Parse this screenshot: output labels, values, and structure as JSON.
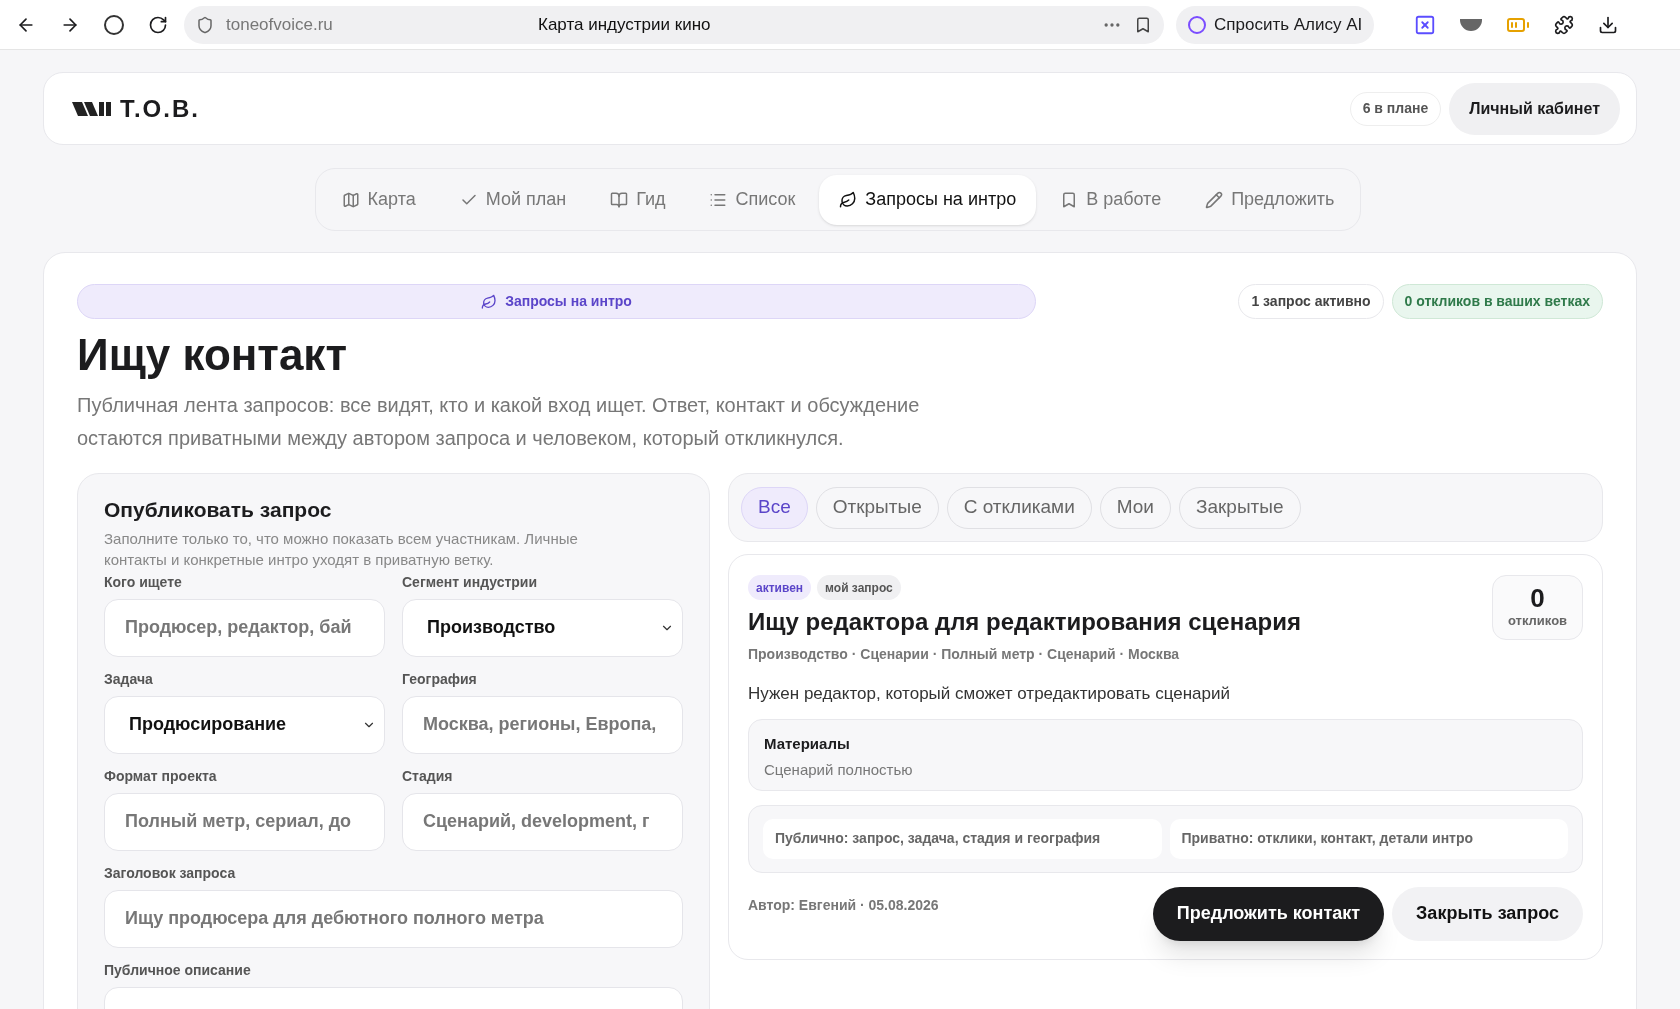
{
  "browser": {
    "url": "toneofvoice.ru",
    "title": "Карта индустрии кино",
    "ask_button": "Спросить Алису AI"
  },
  "header": {
    "logo_text": "Т.О.В.",
    "plan_badge": "6 в плане",
    "account_button": "Личный кабинет"
  },
  "nav": [
    {
      "label": "Карта",
      "selected": false
    },
    {
      "label": "Мой план",
      "selected": false
    },
    {
      "label": "Гид",
      "selected": false
    },
    {
      "label": "Список",
      "selected": false
    },
    {
      "label": "Запросы на интро",
      "selected": true
    },
    {
      "label": "В работе",
      "selected": false
    },
    {
      "label": "Предложить",
      "selected": false
    }
  ],
  "page": {
    "section_badge": "Запросы на интро",
    "stats": [
      {
        "text": "1 запрос активно",
        "kind": "neutral"
      },
      {
        "text": "0 откликов в ваших ветках",
        "kind": "success"
      }
    ],
    "title": "Ищу контакт",
    "description": "Публичная лента запросов: все видят, кто и какой вход ищет. Ответ, контакт и обсуждение остаются приватными между автором запроса и человеком, который откликнулся."
  },
  "form": {
    "title": "Опубликовать запрос",
    "description": "Заполните только то, что можно показать всем участникам. Личные контакты и конкретные интро уходят в приватную ветку.",
    "fields": [
      {
        "label": "Кого ищете",
        "kind": "input",
        "placeholder": "Продюсер, редактор, бай"
      },
      {
        "label": "Сегмент индустрии",
        "kind": "select",
        "value": "Производство"
      },
      {
        "label": "Задача",
        "kind": "select",
        "value": "Продюсирование"
      },
      {
        "label": "География",
        "kind": "input",
        "placeholder": "Москва, регионы, Европа,"
      },
      {
        "label": "Формат проекта",
        "kind": "input",
        "placeholder": "Полный метр, сериал, до"
      },
      {
        "label": "Стадия",
        "kind": "input",
        "placeholder": "Сценарий, development, г"
      },
      {
        "label": "Заголовок запроса",
        "kind": "wide",
        "placeholder": "Ищу продюсера для дебютного полного метра"
      },
      {
        "label": "Публичное описание",
        "kind": "wide"
      }
    ]
  },
  "filters": [
    {
      "label": "Все",
      "selected": true
    },
    {
      "label": "Открытые",
      "selected": false
    },
    {
      "label": "С откликами",
      "selected": false
    },
    {
      "label": "Мои",
      "selected": false
    },
    {
      "label": "Закрытые",
      "selected": false
    }
  ],
  "request": {
    "tags": [
      {
        "text": "активен",
        "kind": "status"
      },
      {
        "text": "мой запрос",
        "kind": "owner"
      }
    ],
    "title": "Ищу редактора для редактирования сценария",
    "meta": "Производство · Сценарии · Полный метр · Сценарий · Москва",
    "responses_count": "0",
    "responses_label": "откликов",
    "description": "Нужен редактор, который сможет отредактировать сценарий",
    "materials": {
      "title": "Материалы",
      "text": "Сценарий полностью"
    },
    "privacy": [
      "Публично: запрос, задача, стадия и география",
      "Приватно: отклики, контакт, детали интро"
    ],
    "author": "Автор: Евгений · 05.08.2026",
    "buttons": [
      {
        "label": "Предложить контакт",
        "kind": "primary"
      },
      {
        "label": "Закрыть запрос",
        "kind": "secondary"
      }
    ]
  }
}
